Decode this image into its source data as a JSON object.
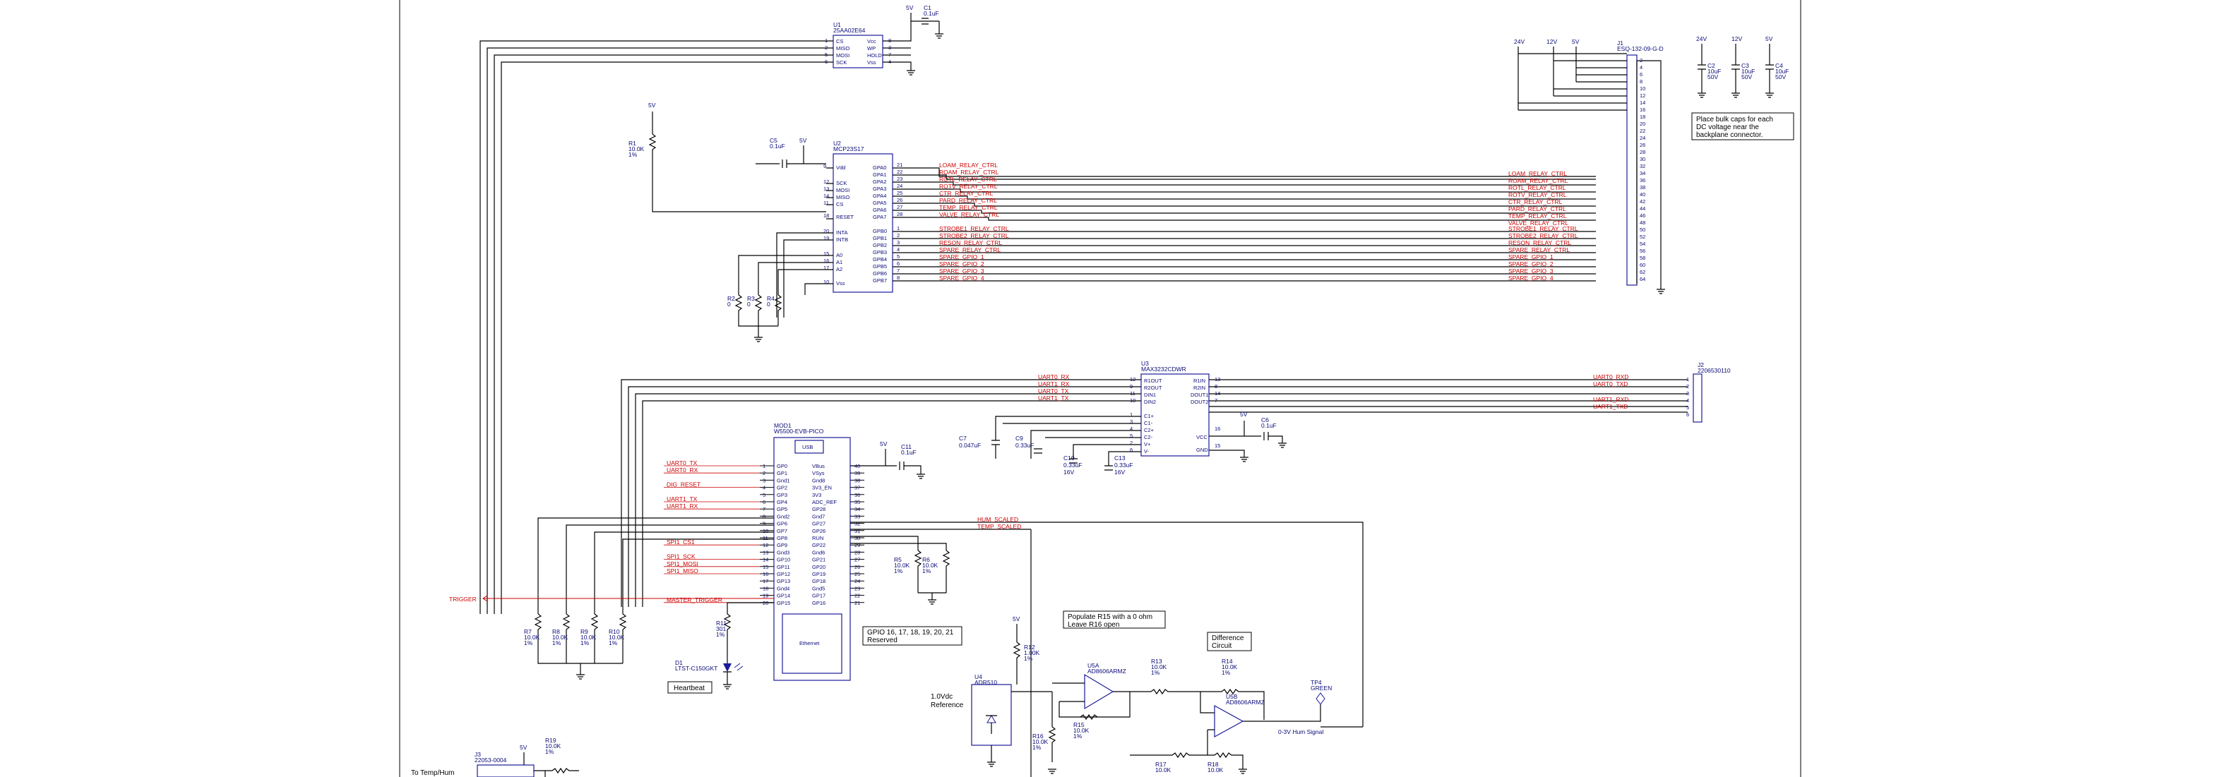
{
  "power": {
    "v5": "5V",
    "v12": "12V",
    "v24": "24V"
  },
  "u1": {
    "ref": "U1",
    "part": "25AA02E64",
    "pins": [
      "CS",
      "MISO",
      "MOSI",
      "SCK",
      "Vcc",
      "WP",
      "HOLD",
      "Vss"
    ],
    "nums": [
      "1",
      "2",
      "5",
      "6",
      "8",
      "3",
      "7",
      "4"
    ]
  },
  "c1": {
    "ref": "C1",
    "val": "0.1uF"
  },
  "r1": {
    "ref": "R1",
    "val": "10.0K",
    "tol": "1%"
  },
  "c5": {
    "ref": "C5",
    "val": "0.1uF"
  },
  "u2": {
    "ref": "U2",
    "part": "MCP23S17",
    "left_pins": [
      "Vdd",
      "SCK",
      "MOSI",
      "MISO",
      "CS",
      "RESET",
      "INTA",
      "INTB",
      "A0",
      "A1",
      "A2",
      "Vss"
    ],
    "left_nums": [
      "9",
      "12",
      "13",
      "14",
      "11",
      "18",
      "20",
      "19",
      "15",
      "16",
      "17",
      "10"
    ],
    "right_pins": [
      "GPA0",
      "GPA1",
      "GPA2",
      "GPA3",
      "GPA4",
      "GPA5",
      "GPA6",
      "GPA7",
      "GPB0",
      "GPB1",
      "GPB2",
      "GPB3",
      "GPB4",
      "GPB5",
      "GPB6",
      "GPB7"
    ],
    "right_nums": [
      "21",
      "22",
      "23",
      "24",
      "25",
      "26",
      "27",
      "28",
      "1",
      "2",
      "3",
      "4",
      "5",
      "6",
      "7",
      "8"
    ]
  },
  "relay_nets": [
    "LOAM_RELAY_CTRL",
    "ROAM_RELAY_CTRL",
    "ROTL_RELAY_CTRL",
    "ROTV_RELAY_CTRL",
    "CTR_RELAY_CTRL",
    "PARD_RELAY_CTRL",
    "TEMP_RELAY_CTRL",
    "VALVE_RELAY_CTRL",
    "STROBE1_RELAY_CTRL",
    "STROBE2_RELAY_CTRL",
    "RESON_RELAY_CTRL",
    "SPARE_RELAY_CTRL",
    "SPARE_GPIO_1",
    "SPARE_GPIO_2",
    "SPARE_GPIO_3",
    "SPARE_GPIO_4"
  ],
  "r2": {
    "ref": "R2",
    "val": "0"
  },
  "r3": {
    "ref": "R3",
    "val": "0"
  },
  "r4": {
    "ref": "R4",
    "val": "0"
  },
  "j1": {
    "ref": "J1",
    "part": "ESQ-132-09-G-D",
    "nums": [
      "2",
      "4",
      "6",
      "8",
      "10",
      "12",
      "14",
      "16",
      "18",
      "20",
      "22",
      "24",
      "26",
      "28",
      "30",
      "32",
      "34",
      "36",
      "38",
      "40",
      "42",
      "44",
      "46",
      "48",
      "50",
      "52",
      "54",
      "56",
      "58",
      "60",
      "62",
      "64"
    ]
  },
  "c2": {
    "ref": "C2",
    "val": "10uF",
    "volt": "50V"
  },
  "c3": {
    "ref": "C3",
    "val": "10uF",
    "volt": "50V"
  },
  "c4": {
    "ref": "C4",
    "val": "10uF",
    "volt": "50V"
  },
  "note_bulk": [
    "Place bulk caps for each",
    "DC voltage near the",
    "backplane connector."
  ],
  "u3": {
    "ref": "U3",
    "part": "MAX3232CDWR",
    "left_pins": [
      "R1OUT",
      "R2OUT",
      "DIN1",
      "DIN2",
      "C1+",
      "C1-",
      "C2+",
      "C2-",
      "V+",
      "V-"
    ],
    "left_nums": [
      "12",
      "9",
      "11",
      "10",
      "1",
      "3",
      "4",
      "5",
      "2",
      "6"
    ],
    "right_pins": [
      "R1IN",
      "R2IN",
      "DOUT1",
      "DOUT2",
      "VCC",
      "GND"
    ],
    "right_nums": [
      "13",
      "8",
      "14",
      "7",
      "16",
      "15"
    ]
  },
  "uart_nets": [
    "UART0_RX",
    "UART1_RX",
    "UART0_TX",
    "UART1_TX"
  ],
  "j2": {
    "ref": "J2",
    "part": "2206530110",
    "nums": [
      "1",
      "2",
      "3",
      "4",
      "5",
      "6"
    ],
    "nets": [
      "UART0_RXD",
      "UART0_TXD",
      "UART1_RXD",
      "UART1_TXD"
    ]
  },
  "c7": {
    "ref": "C7",
    "val": "0.047uF"
  },
  "c9": {
    "ref": "C9",
    "val": "0.33uF"
  },
  "c10": {
    "ref": "C10",
    "val": "0.33uF",
    "volt": "16V"
  },
  "c13": {
    "ref": "C13",
    "val": "0.33uF",
    "volt": "16V"
  },
  "c6": {
    "ref": "C6",
    "val": "0.1uF"
  },
  "c11": {
    "ref": "C11",
    "val": "0.1uF"
  },
  "mod1": {
    "ref": "MOD1",
    "part": "W5500-EVB-PICO",
    "usb": "USB",
    "eth": "Ethernet",
    "left_pins": [
      "GP0",
      "GP1",
      "Gnd1",
      "GP2",
      "GP3",
      "GP4",
      "GP5",
      "Gnd2",
      "GP6",
      "GP7",
      "GP8",
      "GP9",
      "Gnd3",
      "GP10",
      "GP11",
      "GP12",
      "GP13",
      "Gnd4",
      "GP14",
      "GP15"
    ],
    "right_pins": [
      "VBus",
      "VSys",
      "Gnd8",
      "3V3_EN",
      "3V3",
      "ADC_REF",
      "GP28",
      "Gnd7",
      "GP27",
      "GP26",
      "RUN",
      "GP22",
      "Gnd6",
      "GP21",
      "GP20",
      "GP19",
      "GP18",
      "Gnd5",
      "GP17",
      "GP16"
    ],
    "right_nums": [
      "40",
      "39",
      "38",
      "37",
      "36",
      "35",
      "34",
      "33",
      "32",
      "31",
      "30",
      "29",
      "28",
      "27",
      "26",
      "25",
      "24",
      "23",
      "22",
      "21"
    ]
  },
  "mod_left_nets": [
    "UART0_TX",
    "UART0_RX",
    "",
    "DIG_RESET",
    "",
    "UART1_TX",
    "UART1_RX",
    "",
    "",
    "",
    "",
    "SPI1_CS1",
    "",
    "SPI1_SCK",
    "SPI1_MOSI",
    "SPI1_MISO",
    "",
    "",
    "",
    "MASTER_TRIGGER"
  ],
  "hum_nets": [
    "HUM_SCALED",
    "TEMP_SCALED"
  ],
  "trigger": "TRIGGER",
  "r5": {
    "ref": "R5",
    "val": "10.0K",
    "tol": "1%"
  },
  "r6": {
    "ref": "R6",
    "val": "10.0K",
    "tol": "1%"
  },
  "note_gpio": [
    "GPIO 16, 17, 18, 19, 20, 21",
    "Reserved"
  ],
  "r7": {
    "ref": "R7",
    "val": "10.0K",
    "tol": "1%"
  },
  "r8": {
    "ref": "R8",
    "val": "10.0K",
    "tol": "1%"
  },
  "r9": {
    "ref": "R9",
    "val": "10.0K",
    "tol": "1%"
  },
  "r10": {
    "ref": "R10",
    "val": "10.0K",
    "tol": "1%"
  },
  "r11": {
    "ref": "R11",
    "val": "301",
    "tol": "1%"
  },
  "d1": {
    "ref": "D1",
    "part": "LTST-C150GKT"
  },
  "heartbeat": "Heartbeat",
  "note_r15": [
    "Populate R15 with a 0 ohm",
    "Leave R16 open"
  ],
  "r12": {
    "ref": "R12",
    "val": "1.00K",
    "tol": "1%"
  },
  "u4": {
    "ref": "U4",
    "part": "ADR510"
  },
  "ref_label": [
    "1.0Vdc",
    "Reference"
  ],
  "u5a": {
    "ref": "U5A",
    "part": "AD8606ARMZ"
  },
  "u5b": {
    "ref": "U5B",
    "part": "AD8606ARMZ"
  },
  "r13": {
    "ref": "R13",
    "val": "10.0K",
    "tol": "1%"
  },
  "r14": {
    "ref": "R14",
    "val": "10.0K",
    "tol": "1%"
  },
  "r15": {
    "ref": "R15",
    "val": "10.0K",
    "tol": "1%"
  },
  "r16": {
    "ref": "R16",
    "val": "10.0K",
    "tol": "1%"
  },
  "r17": {
    "ref": "R17",
    "val": "10.0K"
  },
  "r18": {
    "ref": "R18",
    "val": "10.0K"
  },
  "r19": {
    "ref": "R19",
    "val": "10.0K",
    "tol": "1%"
  },
  "note_diff": [
    "Difference",
    "Circuit"
  ],
  "tp4": {
    "ref": "TP4",
    "color": "GREEN"
  },
  "hum_signal": "0-3V Hum Signal",
  "j3": {
    "ref": "J3",
    "part": "22053-0004"
  },
  "temp_label": "To Temp/Hum"
}
